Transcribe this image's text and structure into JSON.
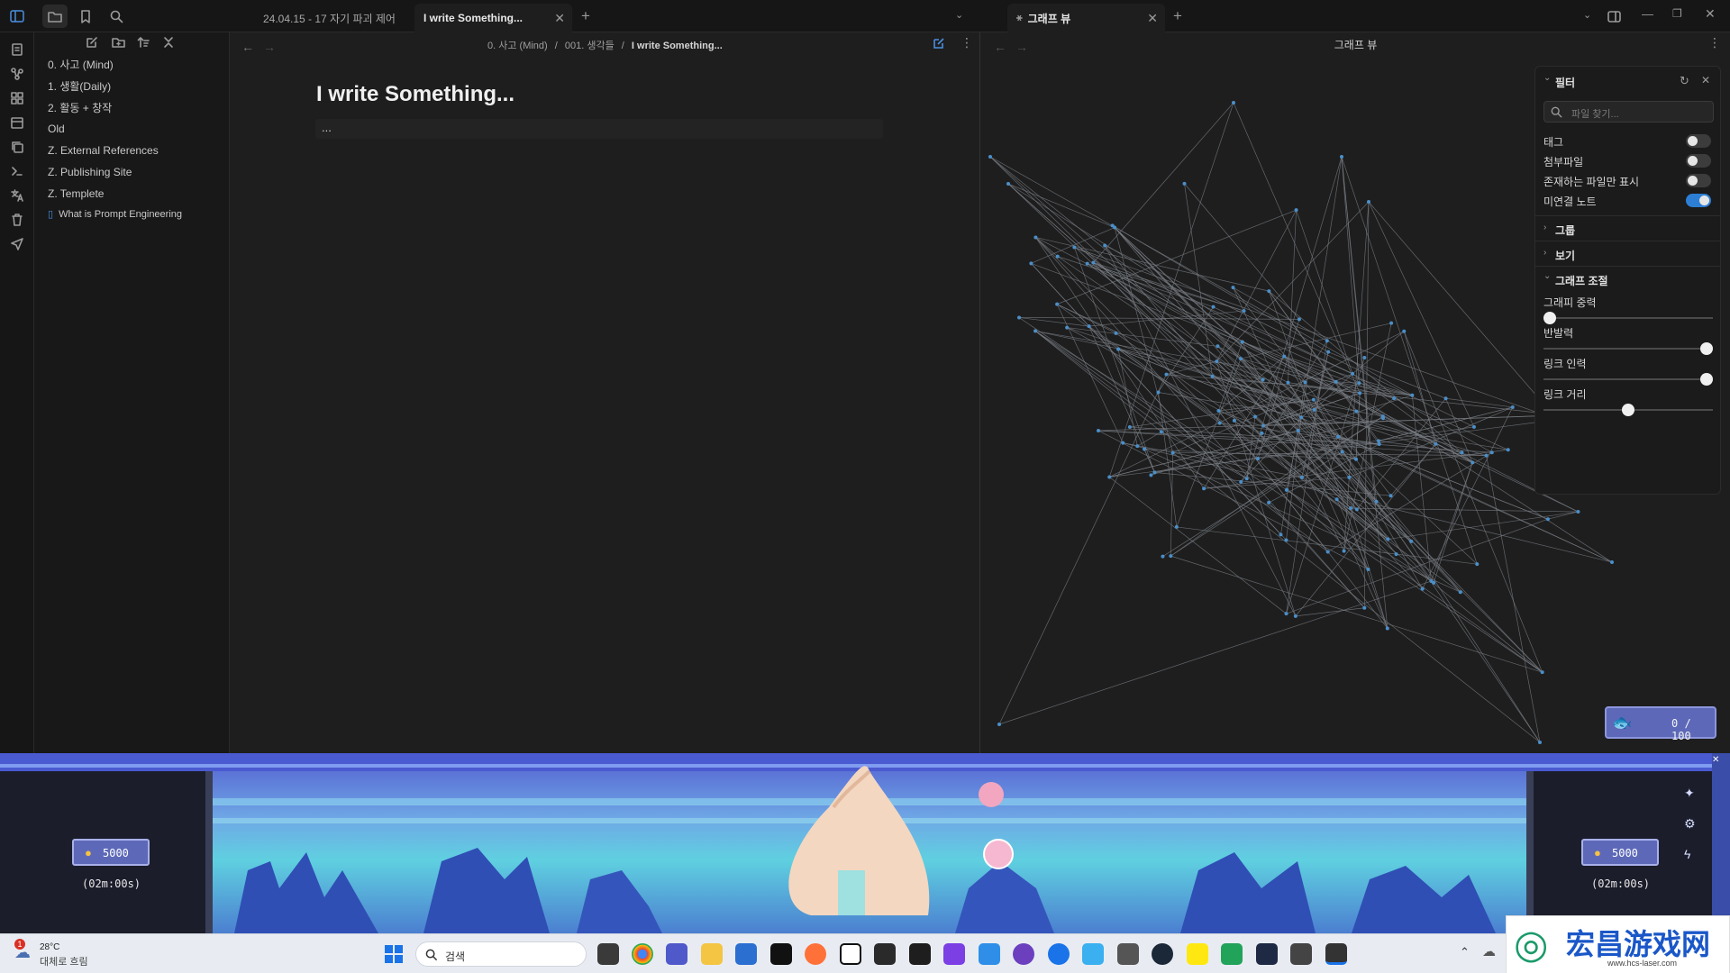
{
  "window": {
    "tabs": [
      {
        "label": "24.04.15 - 17 자기 파괴 제어",
        "active": false
      },
      {
        "label": "I write Something...",
        "active": true
      },
      {
        "label": "그래프 뷰",
        "active": true
      }
    ]
  },
  "sidebar": {
    "items": [
      {
        "label": "0. 사고 (Mind)"
      },
      {
        "label": "1. 생활(Daily)"
      },
      {
        "label": "2. 활동 + 창작"
      },
      {
        "label": "Old"
      },
      {
        "label": "Z. External References"
      },
      {
        "label": "Z. Publishing Site"
      },
      {
        "label": "Z. Templete"
      },
      {
        "label": "What is Prompt Engineering"
      }
    ]
  },
  "editor": {
    "breadcrumb": {
      "part1": "0. 사고 (Mind)",
      "part2": "001. 생각들",
      "current": "I write Something...",
      "sep": "/"
    },
    "title": "I write Something...",
    "body": "..."
  },
  "graph": {
    "title": "그래프 뷰",
    "filter": {
      "header": "필터",
      "search_placeholder": "파일 찾기...",
      "toggles": [
        {
          "label": "태그",
          "on": false
        },
        {
          "label": "첨부파일",
          "on": false
        },
        {
          "label": "존재하는 파일만 표시",
          "on": false
        },
        {
          "label": "미연결 노트",
          "on": true
        }
      ],
      "groups_label": "그룹",
      "display_label": "보기",
      "forces_label": "그래프 조절",
      "sliders": [
        {
          "label": "그래피 중력",
          "value": 0.0
        },
        {
          "label": "반발력",
          "value": 1.0
        },
        {
          "label": "링크 인력",
          "value": 1.0
        },
        {
          "label": "링크 거리",
          "value": 0.5
        }
      ]
    },
    "counter": "0 / 100"
  },
  "game": {
    "coins_left": "5000",
    "timer_left": "(02m:00s)",
    "coins_right": "5000",
    "timer_right": "(02m:00s)"
  },
  "taskbar": {
    "weather_temp": "28°C",
    "weather_desc": "대체로 흐림",
    "weather_badge": "1",
    "search_label": "검색",
    "watermark_title": "宏昌游戏网",
    "watermark_url": "www.hcs-laser.com"
  },
  "colors": {
    "accent": "#2d7fd6",
    "graph_node": "#4a8fc9",
    "graph_link": "#7a7f86",
    "water": "#4aa3d8"
  }
}
